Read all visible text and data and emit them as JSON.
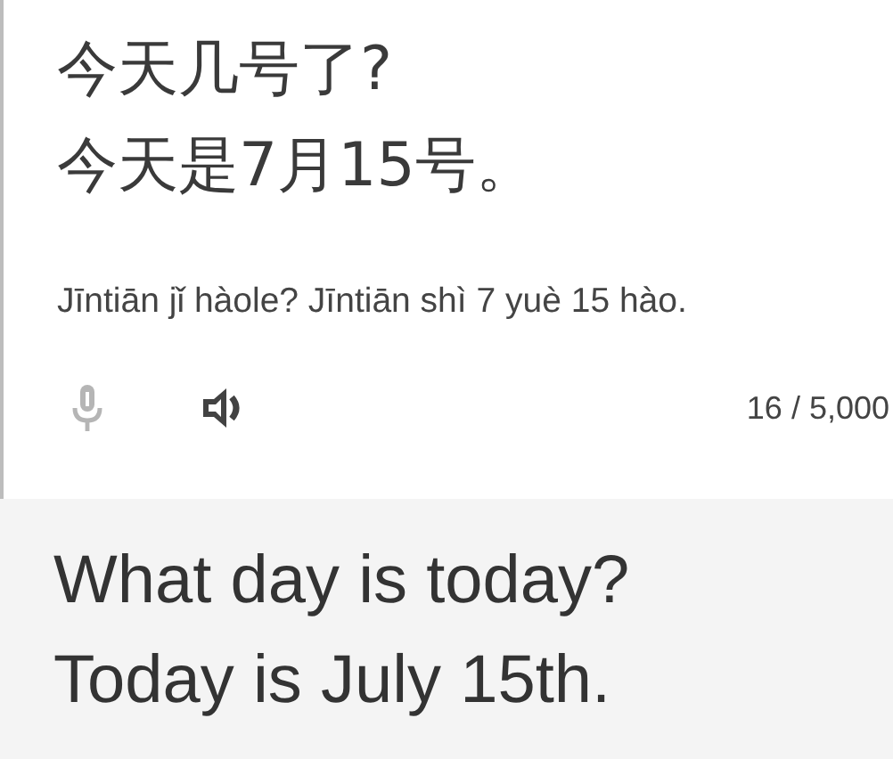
{
  "source": {
    "lines": [
      "今天几号了?",
      "今天是7月15号。"
    ],
    "romanization": "Jīntiān jǐ hàole? Jīntiān shì 7 yuè 15 hào.",
    "char_count": "16 / 5,000"
  },
  "translation": {
    "lines": [
      "What day is today?",
      "Today is July 15th."
    ]
  }
}
